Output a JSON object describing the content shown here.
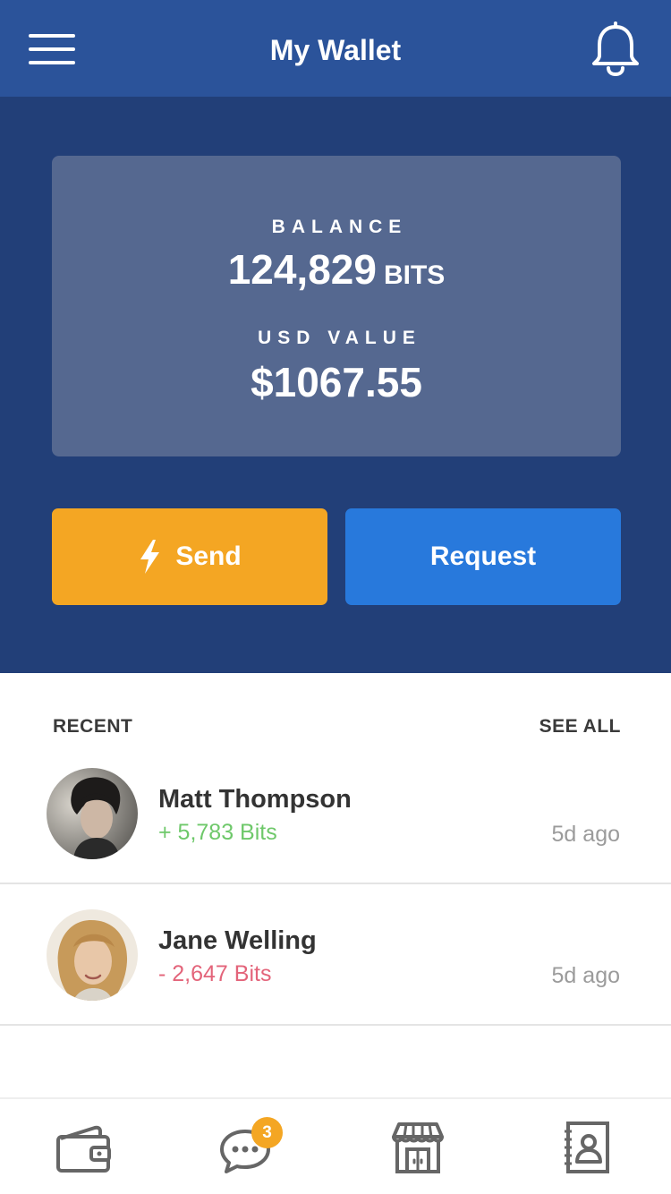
{
  "header": {
    "title": "My Wallet",
    "menu_icon": "hamburger-menu-icon",
    "bell_icon": "bell-icon",
    "color": "#2b539a"
  },
  "balance": {
    "balance_label": "BALANCE",
    "balance_value": "124,829",
    "balance_unit": "BITS",
    "usd_label": "USD VALUE",
    "usd_value": "$1067.55",
    "hero_color": "#223f78",
    "card_color": "#556890"
  },
  "actions": {
    "send_label": "Send",
    "send_icon": "lightning-bolt-icon",
    "send_color": "#f4a623",
    "request_label": "Request",
    "request_color": "#2879dc"
  },
  "recent": {
    "title": "RECENT",
    "see_all": "SEE ALL",
    "transactions": [
      {
        "name": "Matt Thompson",
        "amount": "+ 5,783 Bits",
        "time": "5d ago",
        "direction": "incoming",
        "color": "#6ec86a"
      },
      {
        "name": "Jane Welling",
        "amount": "- 2,647 Bits",
        "time": "5d ago",
        "direction": "outgoing",
        "color": "#e3647a"
      }
    ]
  },
  "tabbar": {
    "tabs": [
      {
        "icon": "wallet-icon"
      },
      {
        "icon": "chat-bubble-icon",
        "badge": "3"
      },
      {
        "icon": "store-icon"
      },
      {
        "icon": "contacts-book-icon"
      }
    ]
  }
}
